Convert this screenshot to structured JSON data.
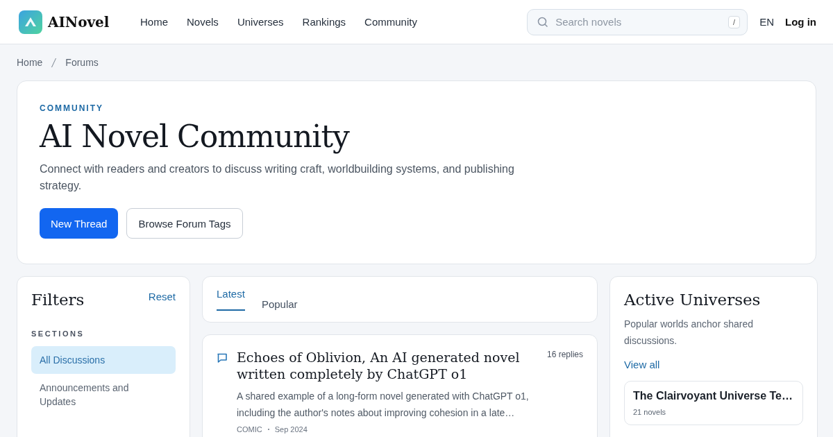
{
  "header": {
    "logo": "AINovel",
    "nav": [
      {
        "label": "Home"
      },
      {
        "label": "Novels"
      },
      {
        "label": "Universes"
      },
      {
        "label": "Rankings"
      },
      {
        "label": "Community"
      }
    ],
    "search": {
      "placeholder": "Search novels",
      "shortcut": "/"
    },
    "language": "EN",
    "login": "Log in"
  },
  "breadcrumb": [
    "Home",
    "Forums"
  ],
  "hero": {
    "eyebrow": "COMMUNITY",
    "title": "AI Novel Community",
    "description": "Connect with readers and creators to discuss writing craft, worldbuilding systems, and publishing strategy.",
    "primary_button": "New Thread",
    "secondary_button": "Browse Forum Tags"
  },
  "filters": {
    "title": "Filters",
    "reset": "Reset",
    "section_label": "SECTIONS",
    "items": [
      {
        "label": "All Discussions",
        "selected": true
      },
      {
        "label": "Announcements and Updates",
        "selected": false
      }
    ]
  },
  "tabs": [
    {
      "label": "Latest",
      "selected": true
    },
    {
      "label": "Popular",
      "selected": false
    }
  ],
  "threads": [
    {
      "title": "Echoes of Oblivion, An AI generated novel written completely by ChatGPT o1",
      "replies": "16 replies",
      "excerpt": "A shared example of a long-form novel generated with ChatGPT o1, including the author's notes about improving cohesion in a late…",
      "tag": "COMIC",
      "date": "Sep 2024"
    }
  ],
  "universes": {
    "title": "Active Universes",
    "description": "Popular worlds anchor shared discussions.",
    "view_all": "View all",
    "items": [
      {
        "name": "The Clairvoyant Universe Te…",
        "count": "21 novels"
      }
    ]
  }
}
